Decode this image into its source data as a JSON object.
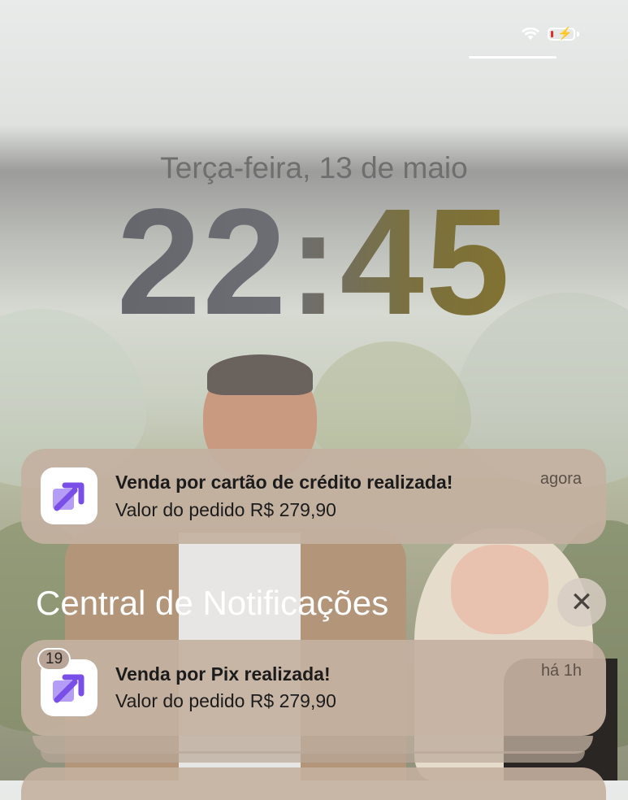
{
  "lock_screen": {
    "date": "Terça-feira, 13 de maio",
    "time": "22:45"
  },
  "status_bar": {
    "battery_level_percent": 5,
    "charging": true,
    "icons": [
      "wifi-icon",
      "battery-icon",
      "charging-bolt-icon"
    ]
  },
  "notification_current": {
    "app_icon": "arrow-square-app-icon",
    "title": "Venda por cartão de crédito realizada!",
    "body": "Valor do pedido R$ 279,90",
    "time": "agora"
  },
  "notification_center": {
    "title": "Central de Notificações",
    "close_icon": "close-icon"
  },
  "notification_stack": {
    "app_icon": "arrow-square-app-icon",
    "count": "19",
    "title": "Venda por Pix realizada!",
    "body": "Valor do pedido R$ 279,90",
    "time": "há 1h"
  },
  "colors": {
    "accent_purple": "#8a5cf0",
    "card_bg": "#c4b0a0"
  }
}
